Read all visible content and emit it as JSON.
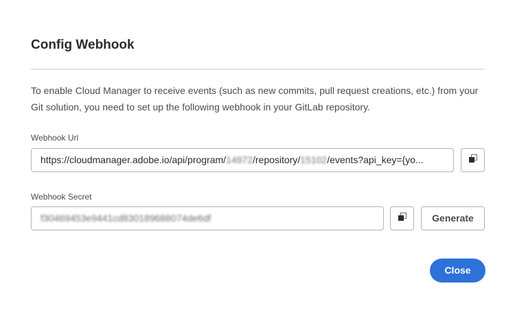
{
  "dialog": {
    "title": "Config Webhook",
    "description": "To enable Cloud Manager to receive events (such as new commits, pull request creations, etc.) from your Git solution, you need to set up the following webhook in your GitLab repository."
  },
  "webhook_url": {
    "label": "Webhook Url",
    "prefix": "https://cloudmanager.adobe.io/api/program/",
    "program_id": "14972",
    "mid": "/repository/",
    "repository_id": "15102",
    "suffix": "/events?api_key={yo..."
  },
  "webhook_secret": {
    "label": "Webhook Secret",
    "value": "f30469453e9441cd830189688074de6df"
  },
  "buttons": {
    "generate_label": "Generate",
    "close_label": "Close"
  },
  "icons": {
    "copy": "copy-icon"
  },
  "colors": {
    "accent": "#2e72d9",
    "border": "#b3b3b3",
    "divider": "#e1e1e1",
    "text": "#2c2c2c"
  }
}
